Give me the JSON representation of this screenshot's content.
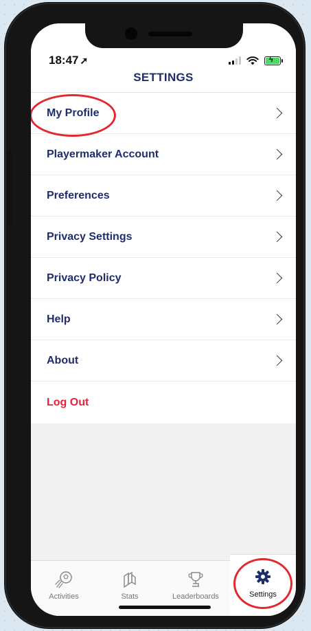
{
  "status": {
    "time": "18:47"
  },
  "header": {
    "title": "SETTINGS"
  },
  "menu": [
    {
      "label": "My Profile"
    },
    {
      "label": "Playermaker Account"
    },
    {
      "label": "Preferences"
    },
    {
      "label": "Privacy Settings"
    },
    {
      "label": "Privacy Policy"
    },
    {
      "label": "Help"
    },
    {
      "label": "About"
    },
    {
      "label": "Log Out"
    }
  ],
  "tabs": [
    {
      "label": "Activities",
      "icon": "soccer-ball-icon"
    },
    {
      "label": "Stats",
      "icon": "stats-cards-icon"
    },
    {
      "label": "Leaderboards",
      "icon": "trophy-icon"
    },
    {
      "label": "Settings",
      "icon": "gear-icon"
    }
  ],
  "colors": {
    "primary": "#1f2d6b",
    "danger": "#e4243a",
    "highlight": "#e3282e"
  }
}
